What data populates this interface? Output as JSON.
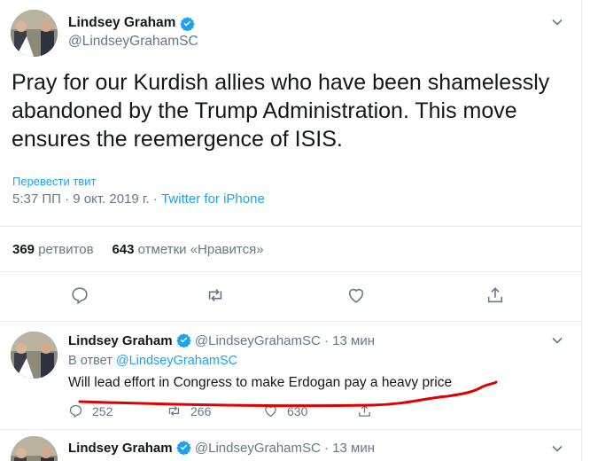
{
  "main_tweet": {
    "author_name": "Lindsey Graham",
    "author_handle": "@LindseyGrahamSC",
    "text": "Pray for our Kurdish allies who have been shamelessly abandoned by the Trump Administration.  This move ensures the reemergence of ISIS.",
    "translate_label": "Перевести твит",
    "timestamp": "5:37 ПП · 9 окт. 2019 г.",
    "separator": "·",
    "source": "Twitter for iPhone",
    "retweets_count": "369",
    "retweets_label": "ретвитов",
    "likes_count": "643",
    "likes_label": "отметки «Нравится»",
    "actions": [
      "reply-icon",
      "retweet-icon",
      "like-icon",
      "share-icon"
    ]
  },
  "reply_tweet": {
    "author_name": "Lindsey Graham",
    "author_handle": "@LindseyGrahamSC",
    "time_ago": "· 13 мин",
    "in_reply_prefix": "В ответ",
    "in_reply_handle": "@LindseyGrahamSC",
    "text": "Will lead effort in Congress to make Erdogan pay a heavy price",
    "reply_count": "252",
    "retweet_count": "266",
    "like_count": "630"
  },
  "next_tweet": {
    "author_name": "Lindsey Graham",
    "author_handle": "@LindseyGrahamSC",
    "time_ago": "· 13 мин"
  },
  "colors": {
    "accent": "#1da1f2",
    "muted": "#657786",
    "text": "#14171a",
    "annotation": "#e00000"
  }
}
